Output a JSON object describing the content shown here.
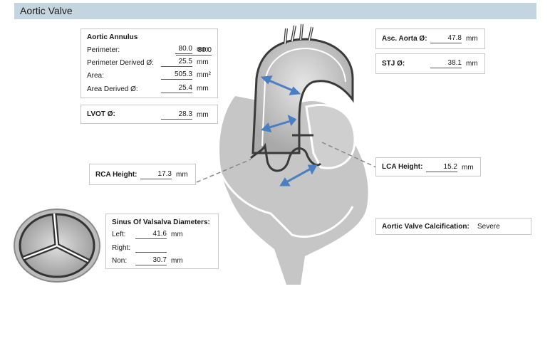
{
  "header": {
    "title": "Aortic Valve"
  },
  "annulus": {
    "title": "Aortic Annulus",
    "rows": [
      {
        "label": "Perimeter:",
        "value": "80.0",
        "unit": "mm"
      },
      {
        "label": "Perimeter Derived Ø:",
        "value": "25.5",
        "unit": "mm"
      },
      {
        "label": "Area:",
        "value": "505.3",
        "unit": "mm²"
      },
      {
        "label": "Area Derived Ø:",
        "value": "25.4",
        "unit": "mm"
      }
    ]
  },
  "lvot": {
    "label": "LVOT Ø:",
    "value": "28.3",
    "unit": "mm"
  },
  "rca": {
    "label": "RCA Height:",
    "value": "17.3",
    "unit": "mm"
  },
  "sinus": {
    "title": "Sinus Of Valsalva Diameters:",
    "rows": [
      {
        "label": "Left:",
        "value": "41.6",
        "unit": "mm"
      },
      {
        "label": "Right:",
        "value": "",
        "unit": ""
      },
      {
        "label": "Non:",
        "value": "30.7",
        "unit": "mm"
      }
    ]
  },
  "asc_aorta": {
    "label": "Asc. Aorta Ø:",
    "value": "47.8",
    "unit": "mm"
  },
  "stj": {
    "label": "STJ Ø:",
    "value": "38.1",
    "unit": "mm"
  },
  "lca": {
    "label": "LCA Height:",
    "value": "15.2",
    "unit": "mm"
  },
  "calcification": {
    "label": "Aortic Valve Calcification:",
    "value": "Severe"
  },
  "colors": {
    "header_bg": "#c5d5df",
    "arrow": "#4a7fc1",
    "heart": "#c9c9c9"
  }
}
